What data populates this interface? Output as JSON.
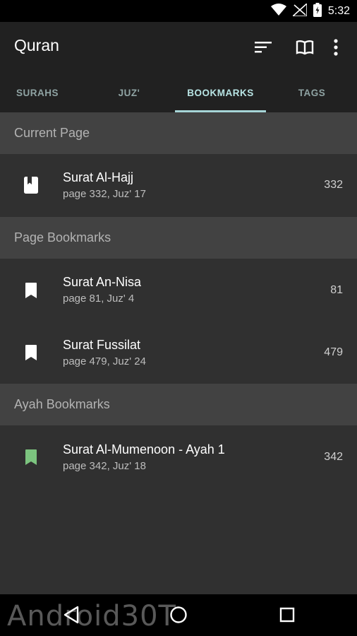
{
  "status_bar": {
    "time": "5:32",
    "icons": [
      "wifi-icon",
      "signal-icon",
      "battery-icon"
    ]
  },
  "app_bar": {
    "title": "Quran",
    "actions": [
      "sort-icon",
      "book-icon",
      "more-vert-icon"
    ]
  },
  "tabs": [
    {
      "label": "SURAHS",
      "active": false
    },
    {
      "label": "JUZ'",
      "active": false
    },
    {
      "label": "BOOKMARKS",
      "active": true
    },
    {
      "label": "TAGS",
      "active": false
    }
  ],
  "sections": [
    {
      "header": "Current Page",
      "items": [
        {
          "title": "Surat Al-Hajj",
          "subtitle": "page 332, Juz' 17",
          "page": "332",
          "icon": "current-page-icon"
        }
      ]
    },
    {
      "header": "Page Bookmarks",
      "items": [
        {
          "title": "Surat An-Nisa",
          "subtitle": "page 81, Juz' 4",
          "page": "81",
          "icon": "bookmark-icon"
        },
        {
          "title": "Surat Fussilat",
          "subtitle": "page 479, Juz' 24",
          "page": "479",
          "icon": "bookmark-icon"
        }
      ]
    },
    {
      "header": "Ayah Bookmarks",
      "items": [
        {
          "title": "Surat Al-Mumenoon - Ayah 1",
          "subtitle": "page 342, Juz' 18",
          "page": "342",
          "icon": "ayah-bookmark-icon"
        }
      ]
    }
  ],
  "colors": {
    "background": "#303030",
    "app_bar": "#212121",
    "section_header": "#424242",
    "tab_active": "#b8e4e4",
    "tab_indicator": "#a6d5d7",
    "ayah_bookmark": "#7cc47f"
  },
  "navigation_bar": {
    "buttons": [
      "back-icon",
      "home-icon",
      "recents-icon"
    ],
    "watermark": "Android30T"
  }
}
